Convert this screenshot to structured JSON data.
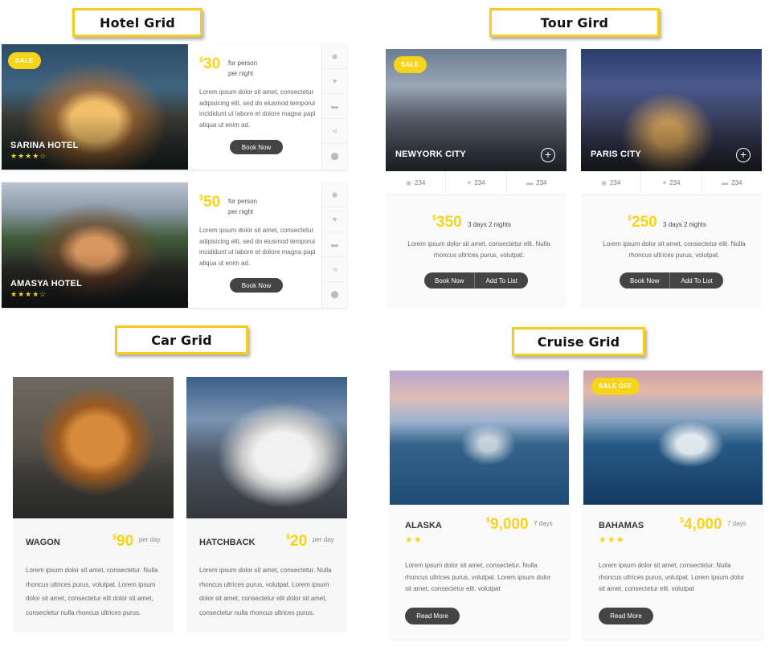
{
  "sections": {
    "hotel_label": "Hotel Grid",
    "tour_label": "Tour Gird",
    "car_label": "Car Grid",
    "cruise_label": "Cruise Grid"
  },
  "lorem_long": "Lorem ipsum dolor sit amet, consectetur adipisicing elit, sed do eiusmod temporui incididunt ut labore et dolore magna papi aliqua ut enim ad.",
  "hotels": [
    {
      "name": "SARINA HOTEL",
      "badge": "SALE",
      "rating_text": "★★★★☆",
      "rating": 4,
      "currency": "$",
      "price": "30",
      "per1": "for person",
      "per2": "per night",
      "button": "Book Now"
    },
    {
      "name": "AMASYA HOTEL",
      "badge": "",
      "rating_text": "★★★★☆",
      "rating": 4,
      "currency": "$",
      "price": "50",
      "per1": "for person",
      "per2": "per night",
      "button": "Book Now"
    }
  ],
  "tours": [
    {
      "name": "NEWYORK CITY",
      "badge": "SALE",
      "views": "234",
      "likes": "234",
      "comments": "234",
      "currency": "$",
      "price": "350",
      "duration": "3 days 2 nights",
      "desc": "Lorem ipsum dolor sit amet, consectetur elit. Nulla rhoncus ultrices purus, volutpat.",
      "book": "Book Now",
      "add": "Add To List"
    },
    {
      "name": "PARIS CITY",
      "badge": "",
      "views": "234",
      "likes": "234",
      "comments": "234",
      "currency": "$",
      "price": "250",
      "duration": "3 days 2 nights",
      "desc": "Lorem ipsum dolor sit amet, consectetur elit. Nulla rhoncus ultrices purus, volutpat.",
      "book": "Book Now",
      "add": "Add To List"
    }
  ],
  "cars": [
    {
      "name": "WAGON",
      "currency": "$",
      "price": "90",
      "per": "per day",
      "desc": "Lorem ipsum dolor sit amet, consectetur. Nulla rhoncus ultrices purus, volutpat. Lorem ipsum dolor sit amet, consectetur elit dolor sit amet, consectetur nulla rhoncus ultrices purus."
    },
    {
      "name": "HATCHBACK",
      "currency": "$",
      "price": "20",
      "per": "per day",
      "desc": "Lorem ipsum dolor sit amet, consectetur. Nulla rhoncus ultrices purus, volutpat. Lorem ipsum dolor sit amet, consectetur elit dolor sit amet, consectetur nulla rhoncus ultrices purus."
    }
  ],
  "cruises": [
    {
      "name": "ALASKA",
      "badge": "",
      "rating_text": "★★",
      "rating": 2,
      "currency": "$",
      "price": "9,000",
      "days": "7 days",
      "desc": "Lorem ipsum dolor sit amet, consectetur. Nulla rhoncus ultrices purus, volutpat. Lorem ipsum dolor sit amet, consectetur elit. volutpat",
      "button": "Read More"
    },
    {
      "name": "BAHAMAS",
      "badge": "SALE OFF",
      "rating_text": "★★★",
      "rating": 3,
      "currency": "$",
      "price": "4,000",
      "days": "7 days",
      "desc": "Lorem ipsum dolor sit amet, consectetur. Nulla rhoncus ultrices purus, volutpat. Lorem ipsum dolor sit amet, consectetur elit. volutpat",
      "button": "Read More"
    }
  ],
  "icons": {
    "hotel_side": [
      "eye-icon",
      "heart-icon",
      "comment-icon",
      "share-icon",
      "map-pin-icon"
    ],
    "tour_stats": [
      "eye-icon",
      "heart-icon",
      "comment-icon"
    ]
  },
  "colors": {
    "accent": "#f7d31a",
    "button": "#444444",
    "label_border": "#f6cd1c"
  }
}
